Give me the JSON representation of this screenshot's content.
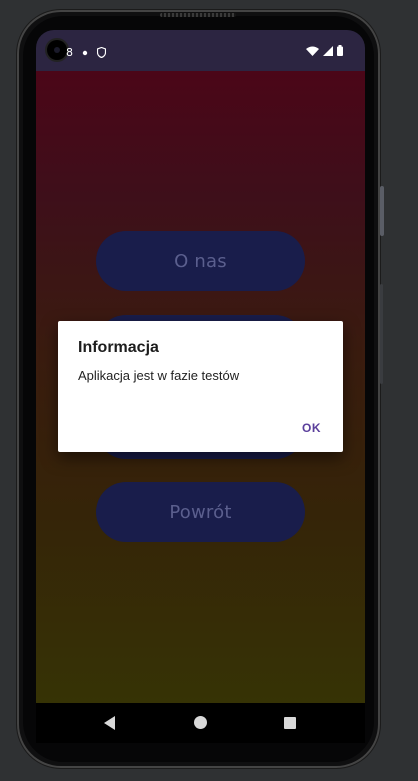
{
  "status_bar": {
    "left_text": "8",
    "icons": [
      "camera-icon",
      "notification-dot-icon",
      "shield-icon"
    ],
    "right_icons": [
      "wifi-icon",
      "signal-icon",
      "battery-icon"
    ]
  },
  "app": {
    "buttons": [
      {
        "label": "O nas"
      },
      {
        "label": "Powrót"
      }
    ],
    "colors": {
      "button_bg": "#191d4b",
      "button_text": "#5b5f8e",
      "status_bar": "#2c2541"
    }
  },
  "dialog": {
    "title": "Informacja",
    "message": "Aplikacja jest w fazie testów",
    "ok_label": "OK"
  },
  "nav_bar": {
    "icons": [
      "back-icon",
      "home-icon",
      "recents-icon"
    ]
  }
}
